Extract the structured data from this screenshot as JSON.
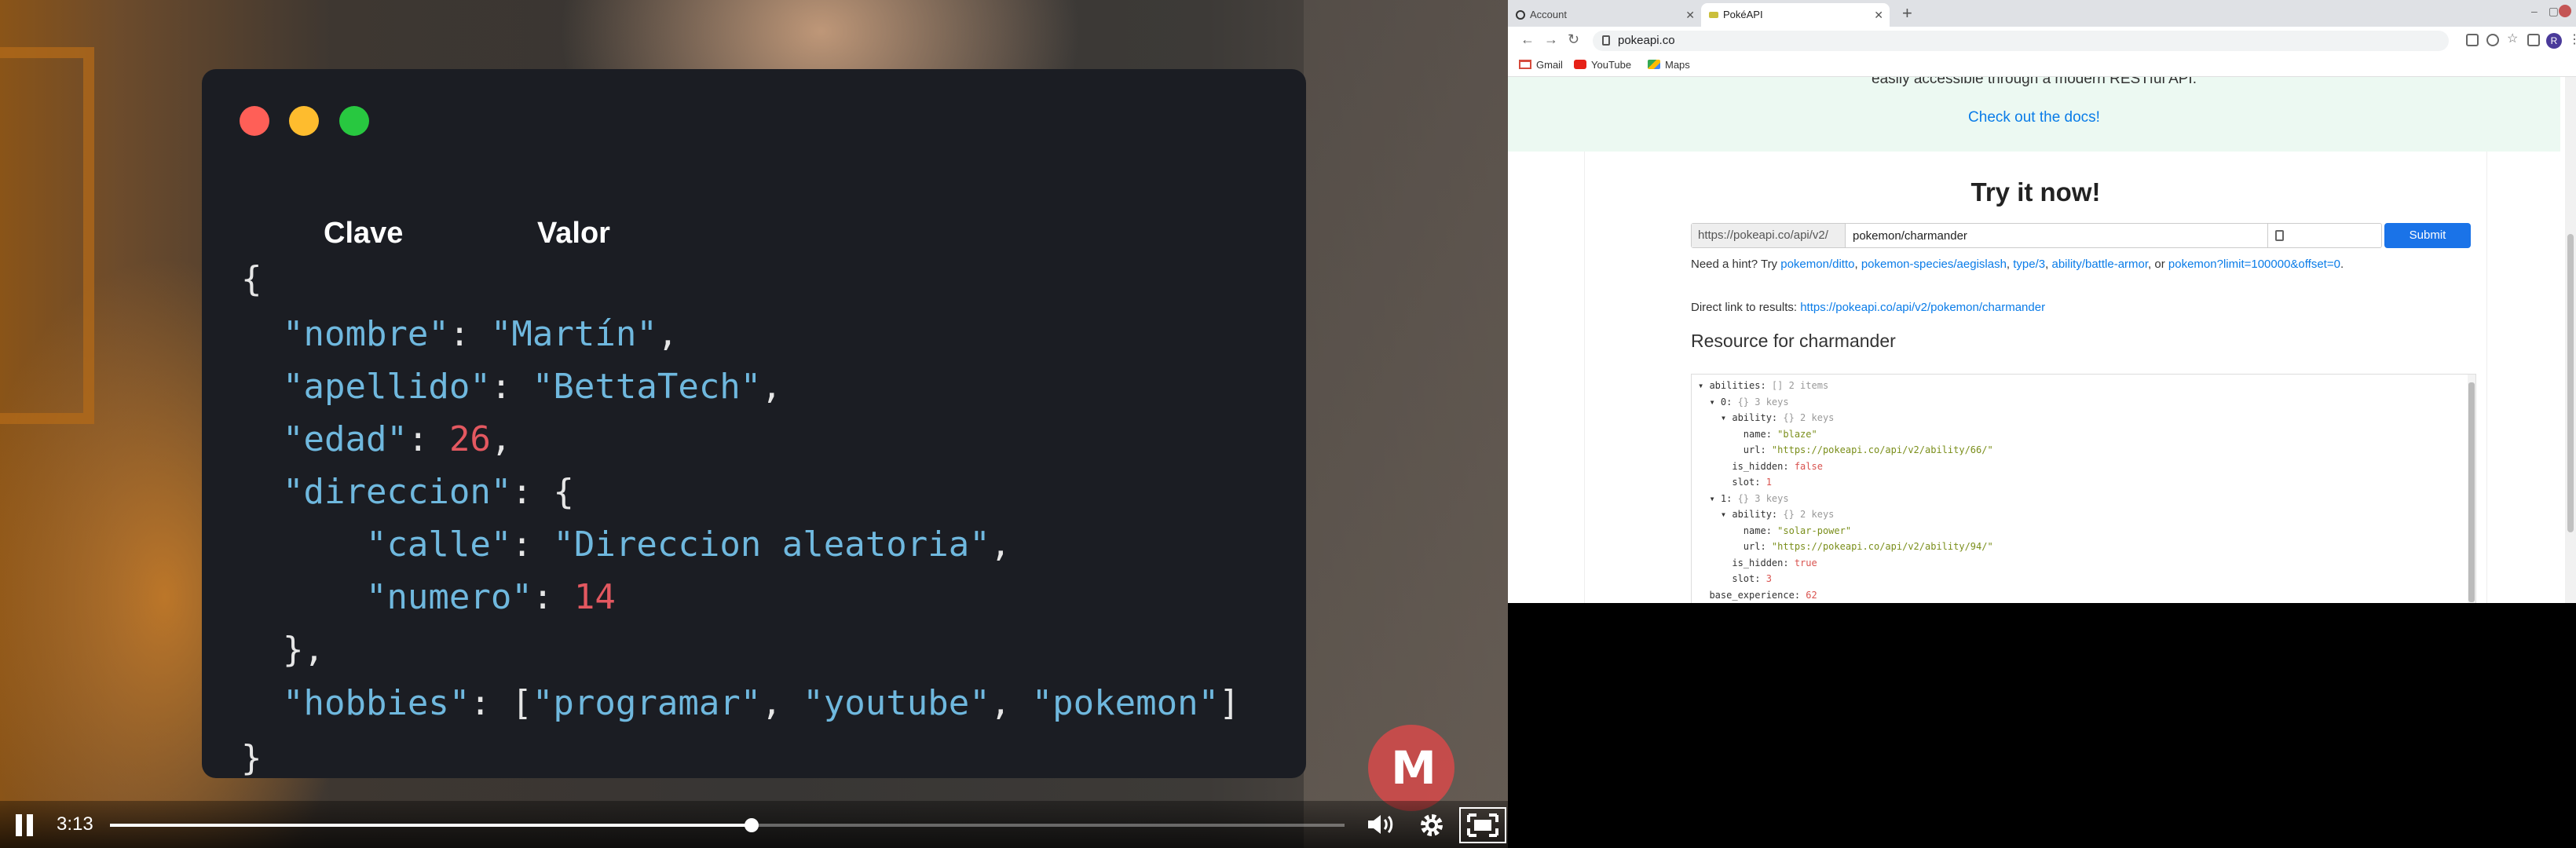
{
  "video": {
    "code_headers": {
      "key": "Clave",
      "value": "Valor"
    },
    "code_lines": [
      "{",
      "  \"nombre\": \"Martín\",",
      "  \"apellido\": \"BettaTech\",",
      "  \"edad\": 26,",
      "  \"direccion\": {",
      "      \"calle\": \"Direccion aleatoria\",",
      "      \"numero\": 14",
      "  },",
      "  \"hobbies\": [\"programar\", \"youtube\", \"pokemon\"]",
      "}"
    ],
    "logo_text": "M",
    "controls": {
      "time": "3:13",
      "progress_fraction": 0.52
    },
    "colors": {
      "key": "#6fb8de",
      "string": "#6fb8de",
      "number": "#e35860",
      "card_bg": "#1b1d23"
    }
  },
  "browser": {
    "tabs": [
      {
        "label": "Account",
        "active": false,
        "icon": "circle-icon"
      },
      {
        "label": "PokéAPI",
        "active": true,
        "icon": "pokeapi-favicon"
      }
    ],
    "address": "pokeapi.co",
    "profile_initial": "R",
    "bookmarks": [
      {
        "label": "Gmail",
        "icon": "gmail-icon"
      },
      {
        "label": "YouTube",
        "icon": "youtube-icon"
      },
      {
        "label": "Maps",
        "icon": "maps-icon"
      }
    ]
  },
  "page": {
    "hero_partial": "easily accessible through a modern RESTful API.",
    "docs_link": "Check out the docs!",
    "try_title": "Try it now!",
    "url_prefix": "https://pokeapi.co/api/v2/",
    "endpoint_value": "pokemon/charmander",
    "submit_label": "Submit",
    "hint_prefix": "Need a hint? Try",
    "hint_links": [
      "pokemon/ditto",
      "pokemon-species/aegislash",
      "type/3",
      "ability/battle-armor",
      "pokemon?limit=100000&offset=0"
    ],
    "hint_or": ", or",
    "direct_label": "Direct link to results:",
    "direct_url": "https://pokeapi.co/api/v2/pokemon/charmander",
    "resource_title": "Resource for charmander",
    "json_lines": [
      "▾ abilities: [] 2 items",
      "  ▾ 0: {} 3 keys",
      "    ▾ ability: {} 2 keys",
      "        name: \"blaze\"",
      "        url: \"https://pokeapi.co/api/v2/ability/66/\"",
      "      is_hidden: false",
      "      slot: 1",
      "  ▾ 1: {} 3 keys",
      "    ▾ ability: {} 2 keys",
      "        name: \"solar-power\"",
      "        url: \"https://pokeapi.co/api/v2/ability/94/\"",
      "      is_hidden: true",
      "      slot: 3",
      "  base_experience: 62"
    ]
  }
}
